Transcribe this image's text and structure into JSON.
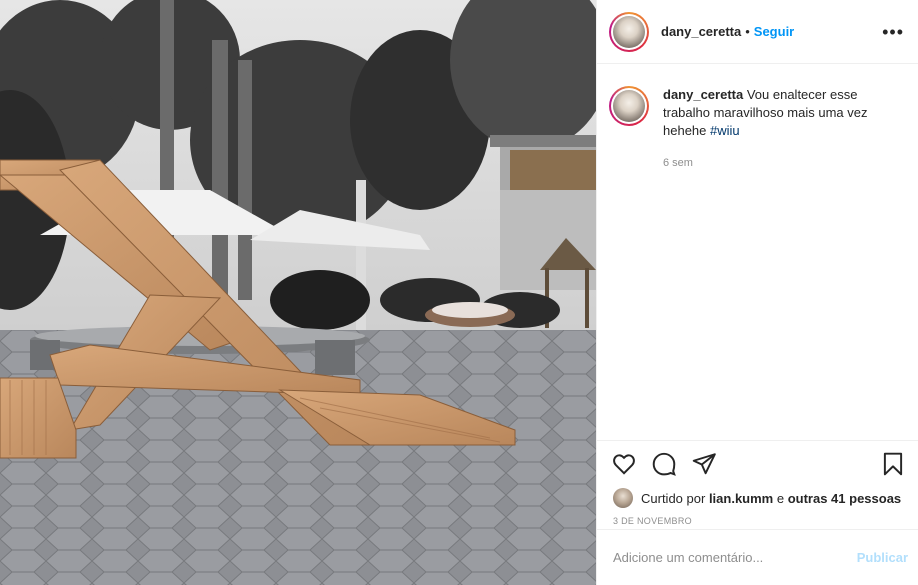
{
  "post": {
    "image_description_icon": "photo",
    "author": {
      "username": "dany_ceretta",
      "follow_label": "Seguir",
      "separator": "•",
      "more_icon": "more-dots-icon",
      "more_label": "•••"
    },
    "caption": {
      "username": "dany_ceretta",
      "text": "Vou enaltecer esse trabalho maravilhoso mais uma vez hehehe ",
      "hashtag": "#wiiu",
      "time_ago": "6 sem"
    },
    "actions": {
      "like_icon": "heart-icon",
      "comment_icon": "comment-icon",
      "share_icon": "share-icon",
      "save_icon": "bookmark-icon"
    },
    "likes": {
      "prefix": "Curtido por ",
      "user": "lian.kumm",
      "middle": " e ",
      "others": "outras 41 pessoas"
    },
    "date": "3 DE NOVEMBRO",
    "add_comment": {
      "placeholder": "Adicione um comentário...",
      "publish_label": "Publicar"
    },
    "colors": {
      "link_blue": "#0095f6",
      "publish_disabled": "#b2dffc",
      "muted": "#8e8e8e",
      "text": "#262626"
    }
  }
}
